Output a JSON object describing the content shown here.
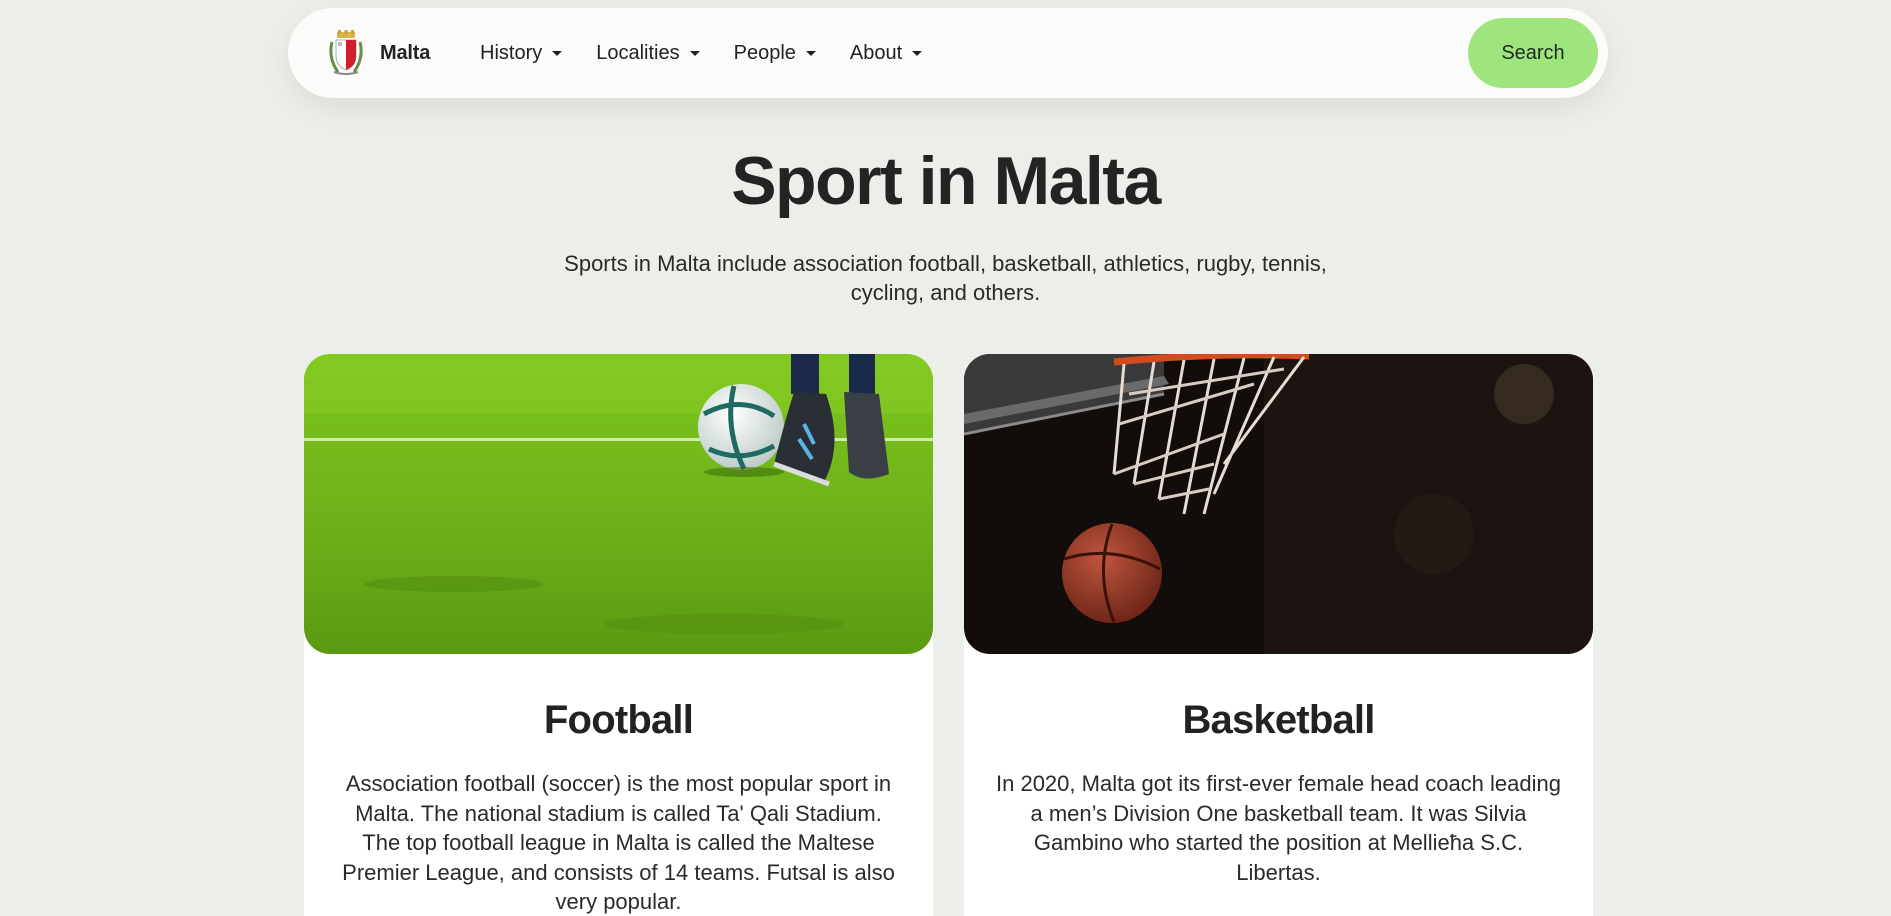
{
  "navbar": {
    "brand_name": "Malta",
    "menu": [
      {
        "label": "History"
      },
      {
        "label": "Localities"
      },
      {
        "label": "People"
      },
      {
        "label": "About"
      }
    ],
    "search_label": "Search",
    "search_color": "#9fe57d"
  },
  "hero": {
    "title": "Sport in Malta",
    "description": "Sports in Malta include association football, basketball, athletics, rugby, tennis, cycling, and others."
  },
  "cards": [
    {
      "title": "Football",
      "text": "Association football (soccer) is the most popular sport in Malta. The national stadium is called Ta' Qali Stadium. The top football league in Malta is called the Maltese Premier League, and consists of 14 teams. Futsal is also very popular."
    },
    {
      "title": "Basketball",
      "text": "In 2020, Malta got its first-ever female head coach leading a men’s Division One basketball team. It was Silvia Gambino who started the position at Mellieħa S.C. Libertas."
    }
  ],
  "icons": {
    "logo": "malta-coat-of-arms-icon",
    "caret": "caret-down-icon"
  },
  "colors": {
    "background": "#eceee9",
    "navbar": "#fbfbfa",
    "accent": "#9fe57d",
    "text": "#222222"
  }
}
